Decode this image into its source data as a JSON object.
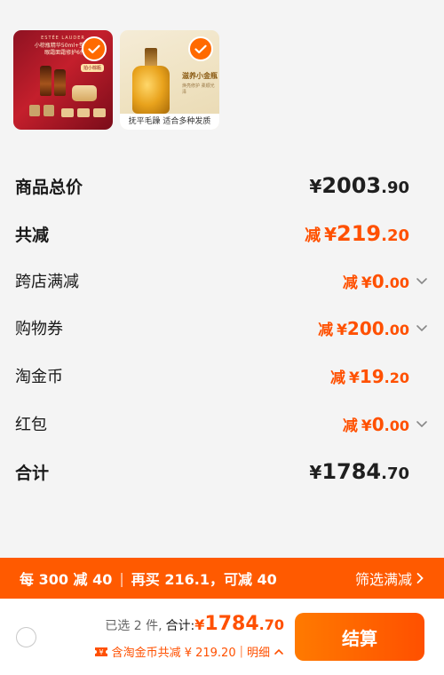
{
  "thumbnails": [
    {
      "brand": "ESTÉE LAUDER",
      "promo_line1": "小棕瓶精华50ml+塑颜抗皱",
      "promo_line2": "眼霜面霜修护6件套",
      "badge": "拍小棕瓶",
      "selected": true
    },
    {
      "label": "滋养小金瓶",
      "sub": "焕亮修护 柔顺光泽",
      "caption": "抚平毛躁 适合多种发质",
      "selected": true
    }
  ],
  "price_rows": {
    "total_goods": {
      "label": "商品总价",
      "currency": "¥",
      "int": "2003",
      "dec": ".90"
    },
    "total_reduce": {
      "label": "共减",
      "minus": "减",
      "currency": "¥",
      "int": "219",
      "dec": ".20"
    },
    "cross_store": {
      "label": "跨店满减",
      "minus": "减",
      "currency": "¥",
      "int": "0",
      "dec": ".00"
    },
    "coupon": {
      "label": "购物券",
      "minus": "减",
      "currency": "¥",
      "int": "200",
      "dec": ".00"
    },
    "taojinbi": {
      "label": "淘金币",
      "minus": "减",
      "currency": "¥",
      "int": "19",
      "dec": ".20"
    },
    "red_packet": {
      "label": "红包",
      "minus": "减",
      "currency": "¥",
      "int": "0",
      "dec": ".00"
    },
    "subtotal": {
      "label": "合计",
      "currency": "¥",
      "int": "1784",
      "dec": ".70"
    }
  },
  "promo_bar": {
    "rule": "每 300 减 40",
    "hint": "再买 216.1，可减 40",
    "filter": "筛选满减"
  },
  "checkout": {
    "selected_count": "已选 2 件,",
    "total_label": "合计:",
    "currency": "¥",
    "total_int": "1784",
    "total_dec": ".70",
    "saving_text": "含淘金币共减 ¥ 219.20",
    "detail": "明细",
    "pay_button": "结算"
  },
  "colors": {
    "accent": "#ff5000",
    "promo_bar": "#ff5a00"
  }
}
